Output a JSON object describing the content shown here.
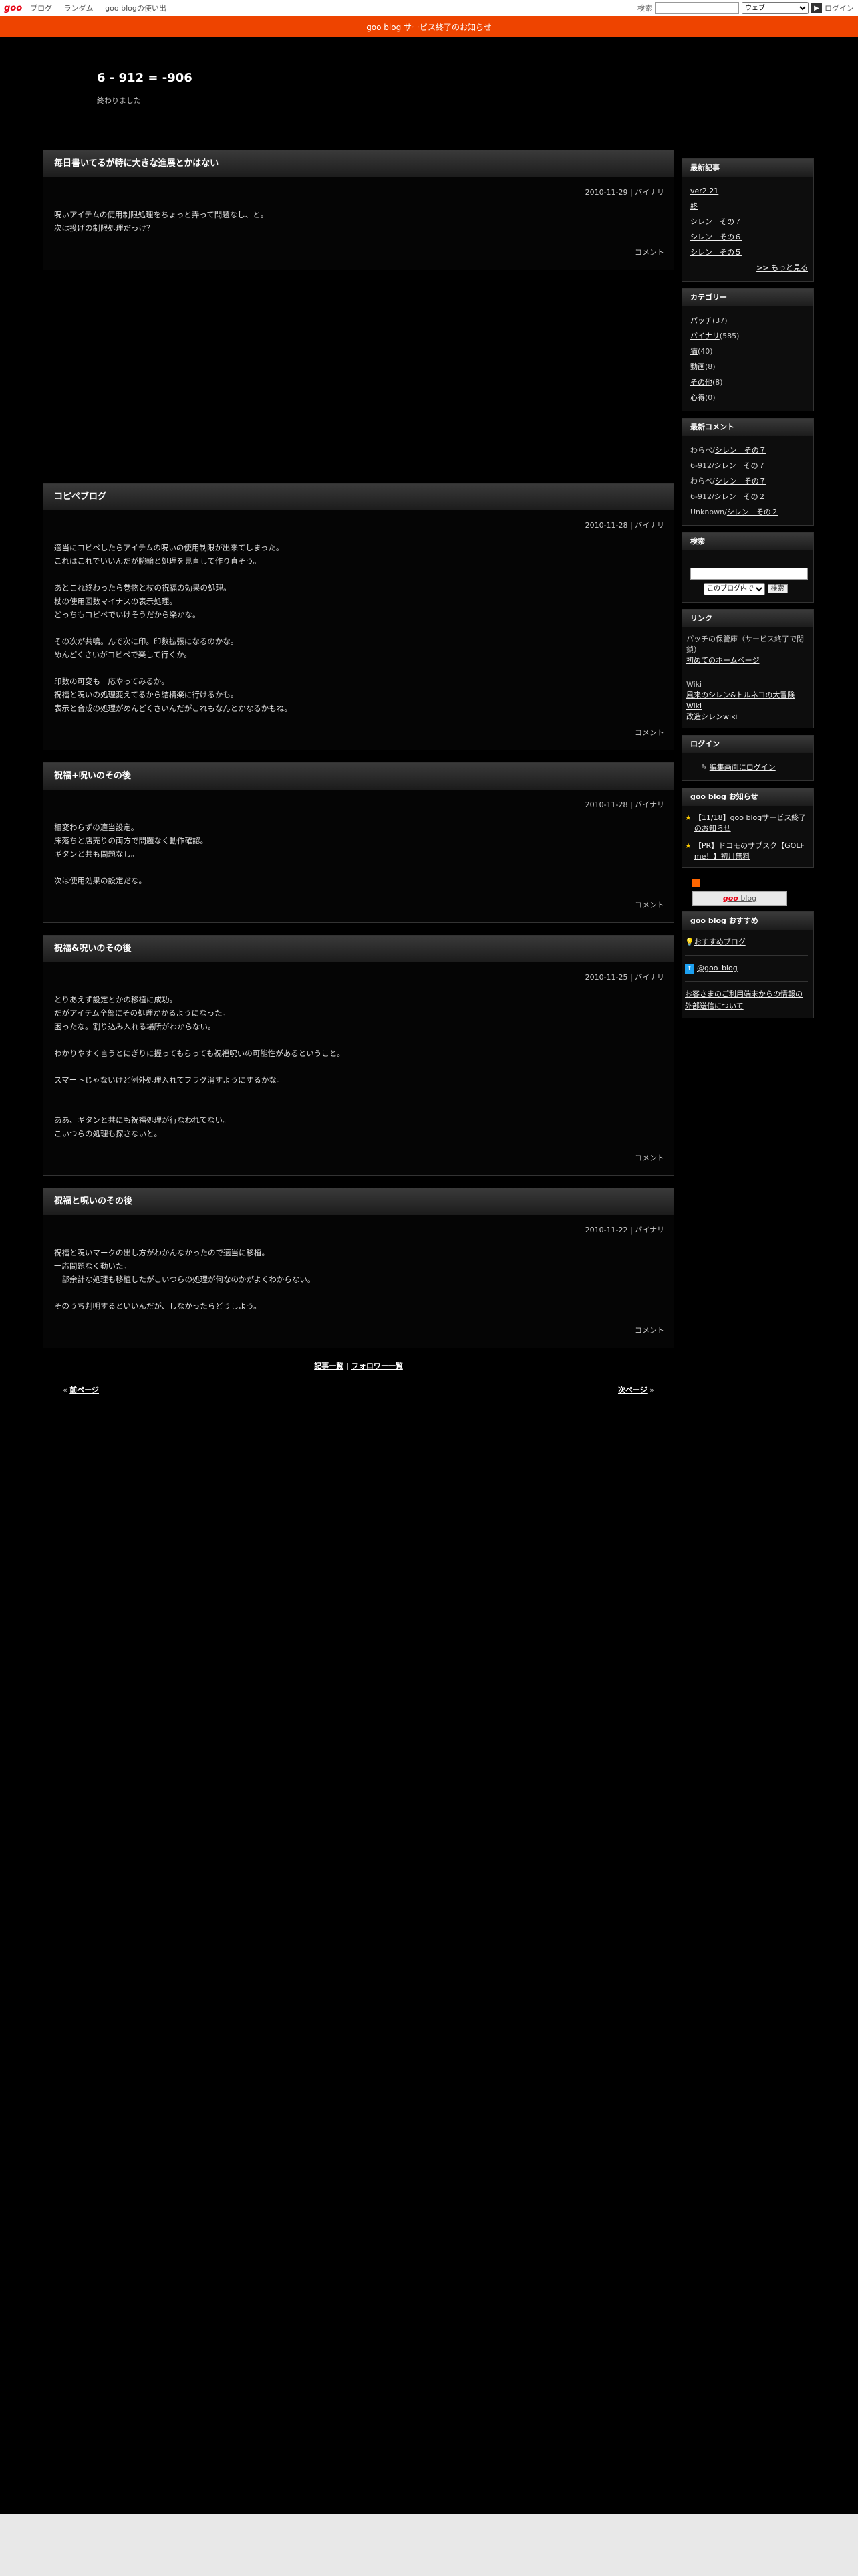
{
  "topbar": {
    "logo": "goo",
    "nav": [
      "ブログ",
      "ランダム",
      "goo blogの使い出"
    ],
    "search_label": "検索",
    "search_select": "ウェブ",
    "login": "ログイン"
  },
  "notice": "goo blog サービス終了のお知らせ",
  "blog": {
    "title": "6 - 912 = -906",
    "desc": "終わりました"
  },
  "entries": [
    {
      "title": "毎日書いてるが特に大きな進展とかはない",
      "date": "2010-11-29 | バイナリ",
      "body": [
        "呪いアイテムの使用制限処理をちょっと弄って問題なし、と。",
        "次は投げの制限処理だっけ？"
      ],
      "comment": "コメント"
    },
    {
      "title": "コピペブログ",
      "date": "2010-11-28 | バイナリ",
      "body": [
        "適当にコピペしたらアイテムの呪いの使用制限が出来てしまった。",
        "これはこれでいいんだが腕輪と処理を見直して作り直そう。",
        "",
        "あとこれ終わったら巻物と杖の祝福の効果の処理。",
        "杖の使用回数マイナスの表示処理。",
        "どっちもコピペでいけそうだから楽かな。",
        "",
        "その次が共鳴。んで次に印。印数拡張になるのかな。",
        "めんどくさいがコピペで楽して行くか。",
        "",
        "印数の可変も一応やってみるか。",
        "祝福と呪いの処理変えてるから結構楽に行けるかも。",
        "表示と合成の処理がめんどくさいんだがこれもなんとかなるかもね。"
      ],
      "comment": "コメント"
    },
    {
      "title": "祝福+呪いのその後",
      "date": "2010-11-28 | バイナリ",
      "body": [
        "相変わらずの適当設定。",
        "床落ちと店売りの両方で問題なく動作確認。",
        "ギタンと共も問題なし。",
        "",
        "次は使用効果の設定だな。"
      ],
      "comment": "コメント"
    },
    {
      "title": "祝福&呪いのその後",
      "date": "2010-11-25 | バイナリ",
      "body": [
        "とりあえず設定とかの移植に成功。",
        "だがアイテム全部にその処理かかるようになった。",
        "困ったな。割り込み入れる場所がわからない。",
        "",
        "わかりやすく言うとにぎりに握ってもらっても祝福呪いの可能性があるということ。",
        "",
        "スマートじゃないけど例外処理入れてフラグ消すようにするかな。",
        "",
        "",
        "ああ、ギタンと共にも祝福処理が行なわれてない。",
        "こいつらの処理も探さないと。"
      ],
      "comment": "コメント"
    },
    {
      "title": "祝福と呪いのその後",
      "date": "2010-11-22 | バイナリ",
      "body": [
        "祝福と呪いマークの出し方がわかんなかったので適当に移植。",
        "一応問題なく動いた。",
        "一部余計な処理も移植したがこいつらの処理が何なのかがよくわからない。",
        "",
        "そのうち判明するといいんだが、しなかったらどうしよう。"
      ],
      "comment": "コメント"
    }
  ],
  "footlinks": {
    "list": "記事一覧",
    "sep": "|",
    "follow": "フォロワー一覧"
  },
  "pager": {
    "prev_mark": "«",
    "prev": "前ページ",
    "next": "次ページ",
    "next_mark": "»"
  },
  "sidebar": {
    "recent": {
      "title": "最新記事",
      "items": [
        "ver2.21",
        "終",
        "シレン　その７",
        "シレン　その６",
        "シレン　その５"
      ],
      "more": ">> もっと見る"
    },
    "category": {
      "title": "カテゴリー",
      "items": [
        {
          "name": "パッチ",
          "count": "(37)"
        },
        {
          "name": "バイナリ",
          "count": "(585)"
        },
        {
          "name": "猫",
          "count": "(40)"
        },
        {
          "name": "動画",
          "count": "(8)"
        },
        {
          "name": "その他",
          "count": "(8)"
        },
        {
          "name": "心得",
          "count": "(0)"
        }
      ]
    },
    "comments": {
      "title": "最新コメント",
      "items": [
        {
          "who": "わらべ/",
          "post": "シレン　その７"
        },
        {
          "who": "6-912/",
          "post": "シレン　その７"
        },
        {
          "who": "わらべ/",
          "post": "シレン　その７"
        },
        {
          "who": "6-912/",
          "post": "シレン　その２"
        },
        {
          "who": "Unknown/",
          "post": "シレン　その２"
        }
      ]
    },
    "search": {
      "title": "検索",
      "select": "このブログ内で",
      "button": "検索"
    },
    "links": {
      "title": "リンク",
      "text1": "パッチの保管庫（サービス終了で閉鎖）",
      "link1": "初めてのホームページ",
      "text2": "Wiki",
      "link2": "風来のシレン&トルネコの大冒険 Wiki",
      "link3": "改造シレンwiki"
    },
    "login": {
      "title": "ログイン",
      "link": "編集画面にログイン"
    },
    "goonews": {
      "title": "goo blog お知らせ",
      "items": [
        "【11/18】goo blogサービス終了のお知らせ",
        "【PR】ドコモのサブスク【GOLF me！】初月無料"
      ],
      "banner_goo": "goo",
      "banner_blog": " blog"
    },
    "recommend": {
      "title": "goo blog おすすめ",
      "item": "おすすめブログ",
      "twitter": "@goo_blog",
      "info": "お客さまのご利用端末からの情報の外部送信について"
    }
  }
}
